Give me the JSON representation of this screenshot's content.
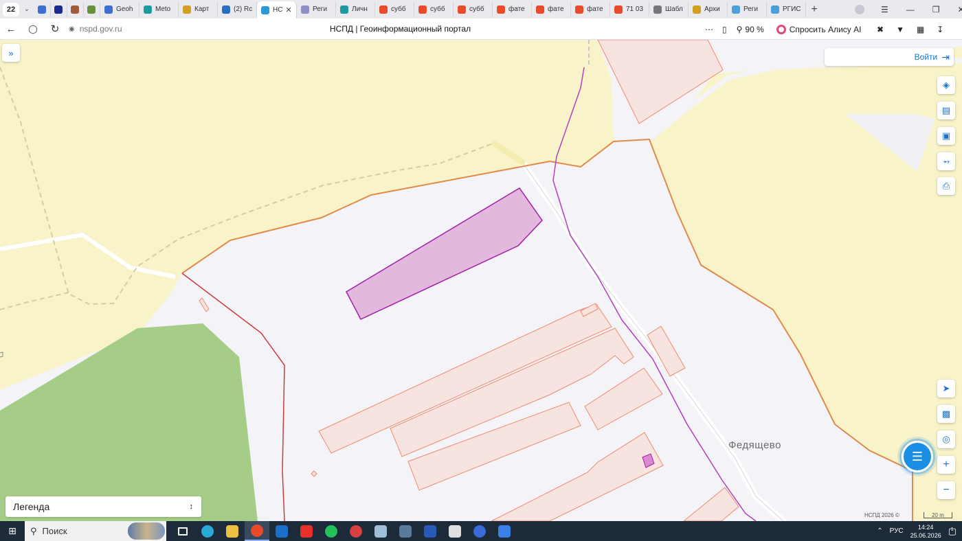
{
  "browser": {
    "tab_count": "22",
    "tabs": [
      {
        "label": "",
        "fav": "#3b6fd0"
      },
      {
        "label": "",
        "fav": "#1b2a8c"
      },
      {
        "label": "",
        "fav": "#a05a3c"
      },
      {
        "label": "",
        "fav": "#6b8e3a"
      },
      {
        "label": "Geoh",
        "fav": "#3b6fd0"
      },
      {
        "label": "Meto",
        "fav": "#1c9aa0"
      },
      {
        "label": "Карт",
        "fav": "#d0a020"
      },
      {
        "label": "(2) Rc",
        "fav": "#2a6fc0"
      },
      {
        "label": "НС",
        "fav": "#2a9ad8",
        "active": true
      },
      {
        "label": "Реги",
        "fav": "#8d8dc8"
      },
      {
        "label": "Личн",
        "fav": "#1c9aa0"
      },
      {
        "label": "субб",
        "fav": "#e84a2a"
      },
      {
        "label": "субб",
        "fav": "#e84a2a"
      },
      {
        "label": "субб",
        "fav": "#e84a2a"
      },
      {
        "label": "фате",
        "fav": "#e84a2a"
      },
      {
        "label": "фате",
        "fav": "#e84a2a"
      },
      {
        "label": "фате",
        "fav": "#e84a2a"
      },
      {
        "label": "71 03",
        "fav": "#e84a2a"
      },
      {
        "label": "Шабл",
        "fav": "#777777"
      },
      {
        "label": "Архи",
        "fav": "#d0a020"
      },
      {
        "label": "Реги",
        "fav": "#4aa0d8"
      },
      {
        "label": "РГИС",
        "fav": "#4aa0d8"
      }
    ],
    "url": "nspd.gov.ru",
    "page_title": "НСПД | Геоинформационный портал",
    "zoom": "90 %",
    "alice_label": "Спросить Алису AI"
  },
  "map": {
    "login_label": "Войти",
    "legend_label": "Легенда",
    "place_label": "Федящево",
    "attribution": "НСПД 2026 ©",
    "scale_label": "20 m",
    "colors": {
      "field": "#f8f3c8",
      "forest": "#a6cd88",
      "plain": "#f4f4f8",
      "parcel_fill": "#f7e3e0",
      "parcel_stroke": "#ee8a70",
      "selected_fill": "#e2b9dd",
      "selected_stroke": "#a21fa8",
      "boundary_orange": "#e08a4a",
      "boundary_red": "#cc3a3a"
    }
  },
  "taskbar": {
    "search_label": "Поиск",
    "lang": "РУС",
    "time": "14:24",
    "date": "25.06.2026",
    "notif_count": "1"
  }
}
